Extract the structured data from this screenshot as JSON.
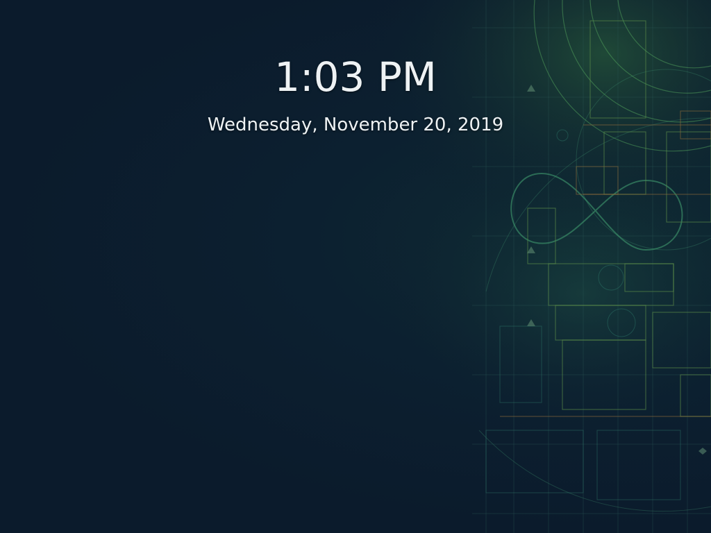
{
  "lock_screen": {
    "time": "1:03 PM",
    "date": "Wednesday, November 20, 2019"
  },
  "wallpaper": {
    "theme": "blueprint-architectural-drawing",
    "background_color": "#0b1b2c",
    "line_color_green": "#3f8a52",
    "line_color_amber": "#8a6a3a",
    "line_color_teal": "#2f7a6a"
  }
}
